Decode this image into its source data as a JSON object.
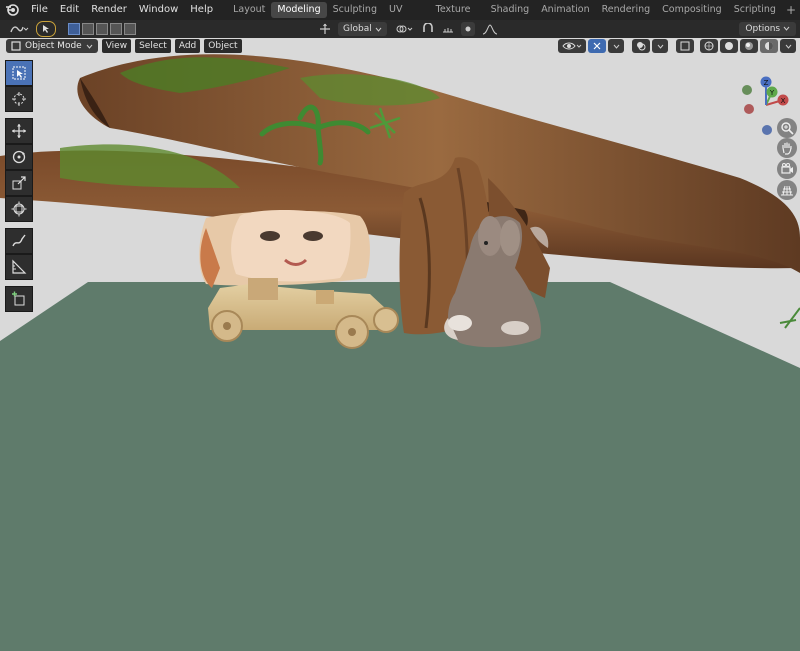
{
  "menubar": {
    "items": [
      "File",
      "Edit",
      "Render",
      "Window",
      "Help"
    ]
  },
  "workspaces": {
    "tabs": [
      "Layout",
      "Modeling",
      "Sculpting",
      "UV Editing",
      "Texture Paint",
      "Shading",
      "Animation",
      "Rendering",
      "Compositing",
      "Scripting"
    ],
    "active": "Modeling",
    "add_label": "+"
  },
  "tool_header": {
    "transform_orientation": "Global",
    "options_label": "Options"
  },
  "viewport_header": {
    "mode": "Object Mode",
    "menus": [
      "View",
      "Select",
      "Add",
      "Object"
    ]
  },
  "gizmo": {
    "x_label": "X",
    "y_label": "Y",
    "z_label": "Z"
  },
  "colors": {
    "accent": "#4a72b6",
    "ground": "#5f7b6b",
    "background": "#d9d9d9"
  }
}
